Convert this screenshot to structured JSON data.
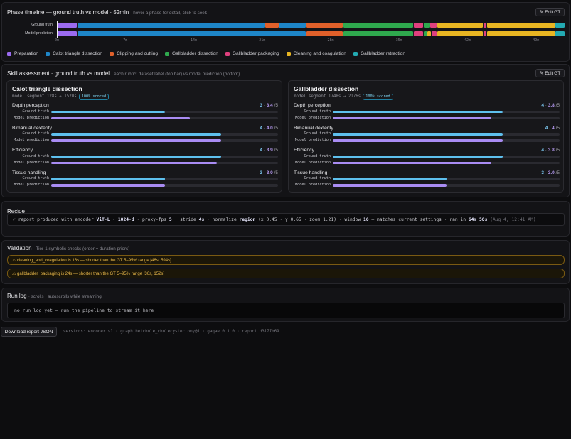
{
  "colors": {
    "preparation": "#9b6bf0",
    "calot": "#1e86c8",
    "clipping": "#e0602a",
    "gallbladder_dissection": "#2fa94e",
    "gallbladder_packaging": "#e0407e",
    "cleaning": "#e8b522",
    "retraction": "#23aab2",
    "gt_bar": "#5ec0ee",
    "pred_bar": "#a98cf3"
  },
  "timeline": {
    "title": "Phase timeline — ground truth vs model · 52min",
    "hint": "· hover a phase for detail, click to seek",
    "edit_label": "Edit GT",
    "rows": [
      {
        "label": "Ground truth",
        "segments": [
          {
            "phase": "preparation",
            "start": 0,
            "end": 2.1
          },
          {
            "phase": "calot",
            "start": 2.1,
            "end": 21.3
          },
          {
            "phase": "clipping",
            "start": 21.3,
            "end": 22.7
          },
          {
            "phase": "calot",
            "start": 22.7,
            "end": 25.5
          },
          {
            "phase": "clipping",
            "start": 25.5,
            "end": 29.3
          },
          {
            "phase": "gallbladder_dissection",
            "start": 29.3,
            "end": 36.5
          },
          {
            "phase": "gallbladder_packaging",
            "start": 36.5,
            "end": 37.5
          },
          {
            "phase": "gallbladder_dissection",
            "start": 37.5,
            "end": 38.2
          },
          {
            "phase": "gallbladder_packaging",
            "start": 38.2,
            "end": 38.9
          },
          {
            "phase": "cleaning",
            "start": 38.9,
            "end": 43.6
          },
          {
            "phase": "gallbladder_packaging",
            "start": 43.6,
            "end": 44.0
          },
          {
            "phase": "cleaning",
            "start": 44.0,
            "end": 51.0
          },
          {
            "phase": "retraction",
            "start": 51.0,
            "end": 52.0
          }
        ]
      },
      {
        "label": "Model prediction",
        "segments": [
          {
            "phase": "preparation",
            "start": 0,
            "end": 2.1
          },
          {
            "phase": "calot",
            "start": 2.1,
            "end": 25.5
          },
          {
            "phase": "clipping",
            "start": 25.5,
            "end": 29.3
          },
          {
            "phase": "gallbladder_dissection",
            "start": 29.3,
            "end": 36.5
          },
          {
            "phase": "gallbladder_packaging",
            "start": 36.5,
            "end": 37.5
          },
          {
            "phase": "gallbladder_dissection",
            "start": 37.5,
            "end": 37.9
          },
          {
            "phase": "cleaning",
            "start": 37.9,
            "end": 38.3
          },
          {
            "phase": "gallbladder_packaging",
            "start": 38.3,
            "end": 38.9
          },
          {
            "phase": "cleaning",
            "start": 38.9,
            "end": 43.6
          },
          {
            "phase": "gallbladder_packaging",
            "start": 43.6,
            "end": 44.0
          },
          {
            "phase": "cleaning",
            "start": 44.0,
            "end": 51.0
          },
          {
            "phase": "retraction",
            "start": 51.0,
            "end": 52.0
          }
        ]
      }
    ],
    "ticks": [
      "0m",
      "7m",
      "14m",
      "21m",
      "28m",
      "35m",
      "42m",
      "49m"
    ],
    "legend": [
      {
        "key": "preparation",
        "label": "Preparation"
      },
      {
        "key": "calot",
        "label": "Calot triangle dissection"
      },
      {
        "key": "clipping",
        "label": "Clipping and cutting"
      },
      {
        "key": "gallbladder_dissection",
        "label": "Gallbladder dissection"
      },
      {
        "key": "gallbladder_packaging",
        "label": "Gallbladder packaging"
      },
      {
        "key": "cleaning",
        "label": "Cleaning and coagulation"
      },
      {
        "key": "retraction",
        "label": "Gallbladder retraction"
      }
    ]
  },
  "skills": {
    "title": "Skill assessment · ground truth vs model",
    "hint": "· each rubric: dataset label (top bar) vs model prediction (bottom)",
    "edit_label": "Edit GT",
    "gt_label": "Ground truth",
    "pred_label": "Model prediction",
    "cards": [
      {
        "title": "Calot triangle dissection",
        "meta": "model segment 128s → 1520s",
        "badge": "100% scored",
        "rubrics": [
          {
            "name": "Depth perception",
            "gt": "3",
            "pred": "3.4",
            "gt_frac": 0.5,
            "pred_frac": 0.61
          },
          {
            "name": "Bimanual dexterity",
            "gt": "4",
            "pred": "4.0",
            "gt_frac": 0.75,
            "pred_frac": 0.75
          },
          {
            "name": "Efficiency",
            "gt": "4",
            "pred": "3.9",
            "gt_frac": 0.75,
            "pred_frac": 0.73
          },
          {
            "name": "Tissue handling",
            "gt": "3",
            "pred": "3.0",
            "gt_frac": 0.5,
            "pred_frac": 0.5
          }
        ]
      },
      {
        "title": "Gallbladder dissection",
        "meta": "model segment 1748s → 2176s",
        "badge": "100% scored",
        "rubrics": [
          {
            "name": "Depth perception",
            "gt": "4",
            "pred": "3.8",
            "gt_frac": 0.75,
            "pred_frac": 0.7
          },
          {
            "name": "Bimanual dexterity",
            "gt": "4",
            "pred": "4",
            "gt_frac": 0.75,
            "pred_frac": 0.75
          },
          {
            "name": "Efficiency",
            "gt": "4",
            "pred": "3.8",
            "gt_frac": 0.75,
            "pred_frac": 0.7
          },
          {
            "name": "Tissue handling",
            "gt": "3",
            "pred": "3.0",
            "gt_frac": 0.5,
            "pred_frac": 0.5
          }
        ]
      }
    ]
  },
  "recipe": {
    "title": "Recipe",
    "check": "✓",
    "t1": "report produced with encoder",
    "encoder": "ViT-L · 1024-d",
    "t2": "· proxy-fps",
    "fps": "5",
    "t3": "· stride",
    "stride": "4s",
    "t4": "· normalize",
    "normalize": "region",
    "t5": "(x 0.45 · y 0.65 · zoom 1.21) · window",
    "window": "16",
    "t6": "— matches current settings · ran in",
    "ran": "64m 58s",
    "when": "(Aug 4, 12:41 AM)"
  },
  "validation": {
    "title": "Validation",
    "hint": "· Tier-1 symbolic checks (order + duration priors)",
    "warnings": [
      "⚠ cleaning_and_coagulation is 16s — shorter than the GT 5–95% range [46s, 594s]",
      "⚠ gallbladder_packaging is 24s — shorter than the GT 5–95% range [36s, 152s]"
    ]
  },
  "runlog": {
    "title": "Run log",
    "hint": "· scrolls · autoscrolls while streaming",
    "text": "no run log yet — run the pipeline to stream it here"
  },
  "footer": {
    "download": "Download report JSON",
    "versions": "versions: encoder v1 · graph heichole_cholecystectomy@1 · gaqae 0.1.0 · report d3177b69"
  }
}
